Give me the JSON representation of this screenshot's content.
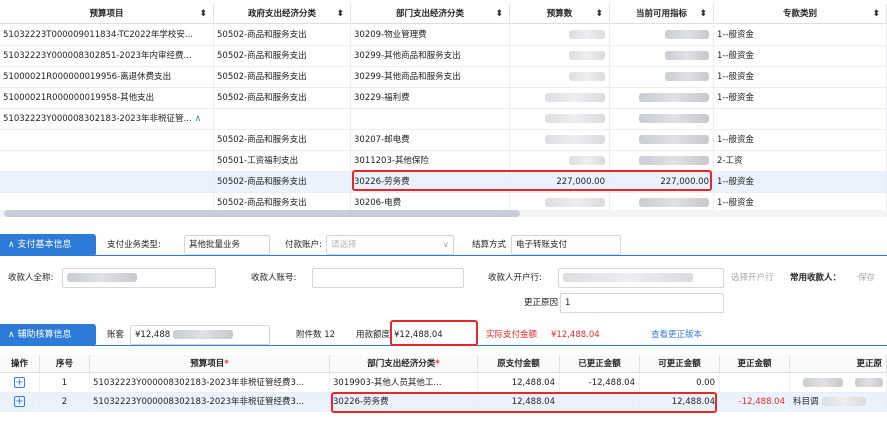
{
  "top_table": {
    "columns": [
      "预算项目",
      "政府支出经济分类",
      "部门支出经济分类",
      "预算数",
      "当前可用指标",
      "专款类别"
    ],
    "rows": [
      {
        "project": "51032223T000009011834-TC2022年学校安...",
        "gov": "50502-商品和服务支出",
        "dept": "30209-物业管理费",
        "budget": "",
        "avail": "",
        "type": "1--般资金"
      },
      {
        "project": "51032223Y000008302851-2023年内审经费...",
        "gov": "50502-商品和服务支出",
        "dept": "30299-其他商品和服务支出",
        "budget": "",
        "avail": "",
        "type": "1--般资金"
      },
      {
        "project": "51000021R000000019956-离退休费支出",
        "gov": "50502-商品和服务支出",
        "dept": "30299-其他商品和服务支出",
        "budget": "",
        "avail": "",
        "type": "1--般资金"
      },
      {
        "project": "51000021R000000019958-其他支出",
        "gov": "50502-商品和服务支出",
        "dept": "30229-福利费",
        "budget": "",
        "avail": "",
        "type": "1--般资金"
      },
      {
        "project": "51032223Y000008302183-2023年非税征管...",
        "gov": "",
        "dept": "",
        "budget": "",
        "avail": "",
        "type": ""
      },
      {
        "project": "",
        "gov": "50502-商品和服务支出",
        "dept": "30207-邮电费",
        "budget": "",
        "avail": "",
        "type": "1--般资金"
      },
      {
        "project": "",
        "gov": "50501-工资福利支出",
        "dept": "3011203-其他保险",
        "budget": "",
        "avail": "",
        "type": "2-工资"
      },
      {
        "project": "",
        "gov": "50502-商品和服务支出",
        "dept": "30226-劳务费",
        "budget": "227,000.00",
        "avail": "227,000.00",
        "type": "1--般资金"
      },
      {
        "project": "",
        "gov": "50502-商品和服务支出",
        "dept": "30206-电费",
        "budget": "",
        "avail": "",
        "type": "1--般资金"
      }
    ]
  },
  "payment_section": {
    "title": "支付基本信息",
    "business_type_label": "支付业务类型:",
    "business_type_value": "其他批量业务",
    "payer_account_label": "付款账户:",
    "payer_account_placeholder": "请选择",
    "settlement_label": "结算方式",
    "settlement_value": "电子转账支付",
    "payee_name_label": "收款人全称:",
    "payee_account_label": "收款人账号:",
    "payee_bank_label": "收款人开户行:",
    "select_bank_button": "选择开户行",
    "common_payee_label": "常用收款人：",
    "common_payee_link": "保存",
    "correction_reason_label": "更正原因",
    "correction_reason_value": "1"
  },
  "aux_section": {
    "title": "辅助核算信息",
    "ledger_label": "账套",
    "ledger_value": "¥12,488",
    "attachments_label": "附件数",
    "attachments_value": "12",
    "amount_label": "用款额度",
    "amount_value": "¥12,488.04",
    "actual_pay_label": "实际支付金额",
    "actual_pay_value": "¥12,488.04",
    "view_version_link": "查看更正版本"
  },
  "bottom_table": {
    "columns": [
      "操作",
      "序号",
      "预算项目",
      "部门支出经济分类",
      "原支付金额",
      "已更正金额",
      "可更正金额",
      "更正金额",
      "更正原"
    ],
    "required_marks": [
      "*",
      "*"
    ],
    "rows": [
      {
        "op": "+",
        "idx": "1",
        "project": "51032223Y000008302183-2023年非税征管经费3...",
        "dept": "3019903-其他人员其他工...",
        "orig": "12,488.04",
        "corrected": "-12,488.04",
        "available": "0.00",
        "correction": "",
        "note": ""
      },
      {
        "op": "+",
        "idx": "2",
        "project": "51032223Y000008302183-2023年非税征管经费3...",
        "dept": "30226-劳务费",
        "orig": "12,488.04",
        "corrected": "",
        "available": "12,488.04",
        "correction": "-12,488.04",
        "note": "科目调"
      }
    ]
  },
  "icons": {
    "sort": "sort-icon",
    "collapse": "chevron-up-icon",
    "dropdown": "chevron-down-icon",
    "add": "plus-icon"
  },
  "colors": {
    "accent": "#2d7bd8",
    "highlight": "#e62828",
    "selected_row": "#eaf2fd"
  }
}
